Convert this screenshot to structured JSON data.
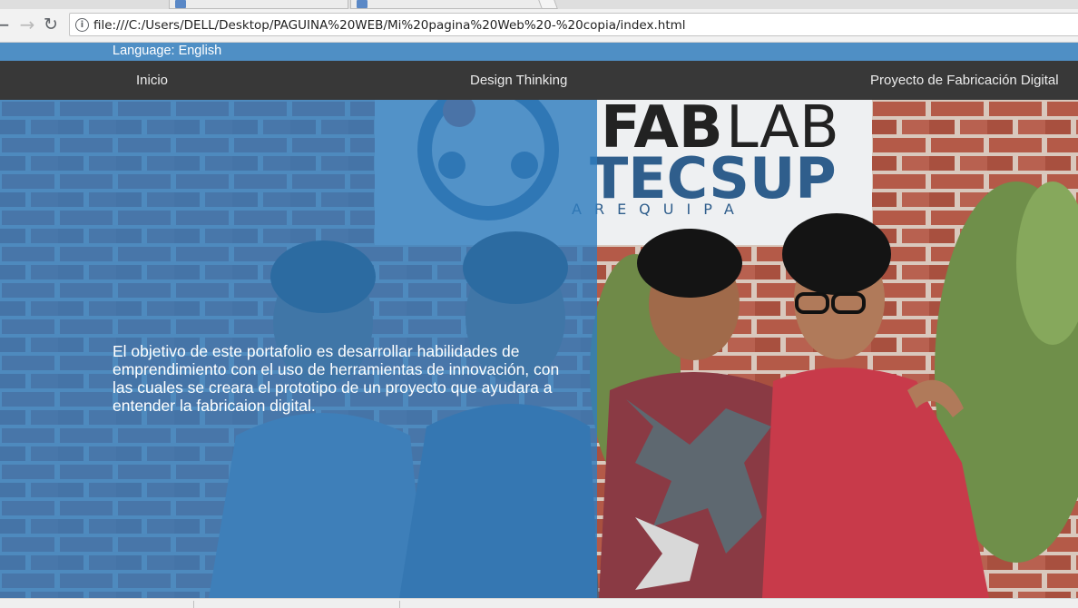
{
  "browser": {
    "url": "file:///C:/Users/DELL/Desktop/PAGUINA%20WEB/Mi%20pagina%20Web%20-%20copia/index.html",
    "icons": [
      "back-arrow-icon",
      "forward-arrow-icon",
      "reload-icon",
      "info-icon"
    ]
  },
  "page": {
    "language_label": "Language: English",
    "nav": {
      "inicio": "Inicio",
      "design": "Design Thinking",
      "proyecto": "Proyecto de Fabricación Digital"
    },
    "hero": {
      "text": "El objetivo de este portafolio es desarrollar habilidades de emprendimiento con el uso de herramientas de innovación, con las cuales se creara el prototipo de un proyecto que ayudara a entender la fabricaion digital.",
      "sign": {
        "line1a": "FAB",
        "line1b": "LAB",
        "line2": "TECSUP",
        "line3": "AREQUIPA"
      }
    },
    "colors": {
      "lang_bar": "#4f8fc5",
      "nav_bar": "#383838",
      "overlay": "#307dbe"
    }
  }
}
